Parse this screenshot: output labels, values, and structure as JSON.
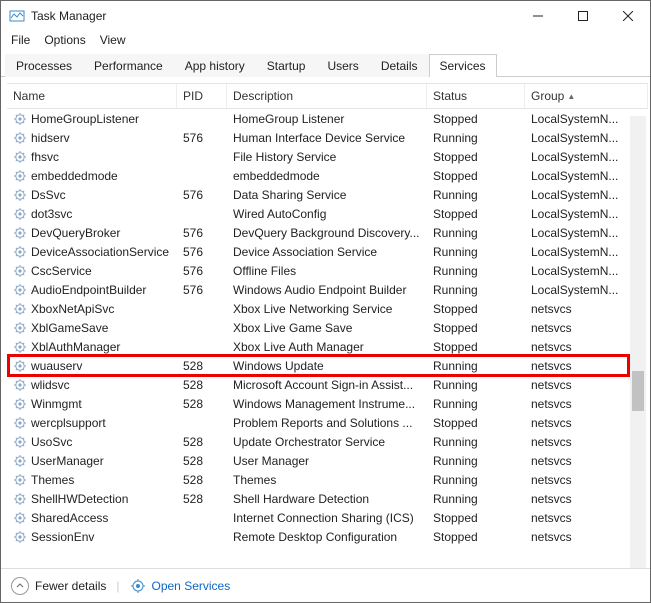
{
  "window": {
    "title": "Task Manager",
    "menus": [
      "File",
      "Options",
      "View"
    ],
    "tabs": [
      "Processes",
      "Performance",
      "App history",
      "Startup",
      "Users",
      "Details",
      "Services"
    ],
    "active_tab_index": 6
  },
  "table": {
    "columns": [
      "Name",
      "PID",
      "Description",
      "Status",
      "Group"
    ],
    "rows": [
      {
        "name": "HomeGroupListener",
        "pid": "",
        "desc": "HomeGroup Listener",
        "status": "Stopped",
        "group": "LocalSystemN..."
      },
      {
        "name": "hidserv",
        "pid": "576",
        "desc": "Human Interface Device Service",
        "status": "Running",
        "group": "LocalSystemN..."
      },
      {
        "name": "fhsvc",
        "pid": "",
        "desc": "File History Service",
        "status": "Stopped",
        "group": "LocalSystemN..."
      },
      {
        "name": "embeddedmode",
        "pid": "",
        "desc": "embeddedmode",
        "status": "Stopped",
        "group": "LocalSystemN..."
      },
      {
        "name": "DsSvc",
        "pid": "576",
        "desc": "Data Sharing Service",
        "status": "Running",
        "group": "LocalSystemN..."
      },
      {
        "name": "dot3svc",
        "pid": "",
        "desc": "Wired AutoConfig",
        "status": "Stopped",
        "group": "LocalSystemN..."
      },
      {
        "name": "DevQueryBroker",
        "pid": "576",
        "desc": "DevQuery Background Discovery...",
        "status": "Running",
        "group": "LocalSystemN..."
      },
      {
        "name": "DeviceAssociationService",
        "pid": "576",
        "desc": "Device Association Service",
        "status": "Running",
        "group": "LocalSystemN..."
      },
      {
        "name": "CscService",
        "pid": "576",
        "desc": "Offline Files",
        "status": "Running",
        "group": "LocalSystemN..."
      },
      {
        "name": "AudioEndpointBuilder",
        "pid": "576",
        "desc": "Windows Audio Endpoint Builder",
        "status": "Running",
        "group": "LocalSystemN..."
      },
      {
        "name": "XboxNetApiSvc",
        "pid": "",
        "desc": "Xbox Live Networking Service",
        "status": "Stopped",
        "group": "netsvcs"
      },
      {
        "name": "XblGameSave",
        "pid": "",
        "desc": "Xbox Live Game Save",
        "status": "Stopped",
        "group": "netsvcs"
      },
      {
        "name": "XblAuthManager",
        "pid": "",
        "desc": "Xbox Live Auth Manager",
        "status": "Stopped",
        "group": "netsvcs"
      },
      {
        "name": "wuauserv",
        "pid": "528",
        "desc": "Windows Update",
        "status": "Running",
        "group": "netsvcs"
      },
      {
        "name": "wlidsvc",
        "pid": "528",
        "desc": "Microsoft Account Sign-in Assist...",
        "status": "Running",
        "group": "netsvcs"
      },
      {
        "name": "Winmgmt",
        "pid": "528",
        "desc": "Windows Management Instrume...",
        "status": "Running",
        "group": "netsvcs"
      },
      {
        "name": "wercplsupport",
        "pid": "",
        "desc": "Problem Reports and Solutions ...",
        "status": "Stopped",
        "group": "netsvcs"
      },
      {
        "name": "UsoSvc",
        "pid": "528",
        "desc": "Update Orchestrator Service",
        "status": "Running",
        "group": "netsvcs"
      },
      {
        "name": "UserManager",
        "pid": "528",
        "desc": "User Manager",
        "status": "Running",
        "group": "netsvcs"
      },
      {
        "name": "Themes",
        "pid": "528",
        "desc": "Themes",
        "status": "Running",
        "group": "netsvcs"
      },
      {
        "name": "ShellHWDetection",
        "pid": "528",
        "desc": "Shell Hardware Detection",
        "status": "Running",
        "group": "netsvcs"
      },
      {
        "name": "SharedAccess",
        "pid": "",
        "desc": "Internet Connection Sharing (ICS)",
        "status": "Stopped",
        "group": "netsvcs"
      },
      {
        "name": "SessionEnv",
        "pid": "",
        "desc": "Remote Desktop Configuration",
        "status": "Stopped",
        "group": "netsvcs"
      }
    ],
    "highlighted_row_index": 13
  },
  "footer": {
    "fewer_label": "Fewer details",
    "open_services_label": "Open Services"
  }
}
